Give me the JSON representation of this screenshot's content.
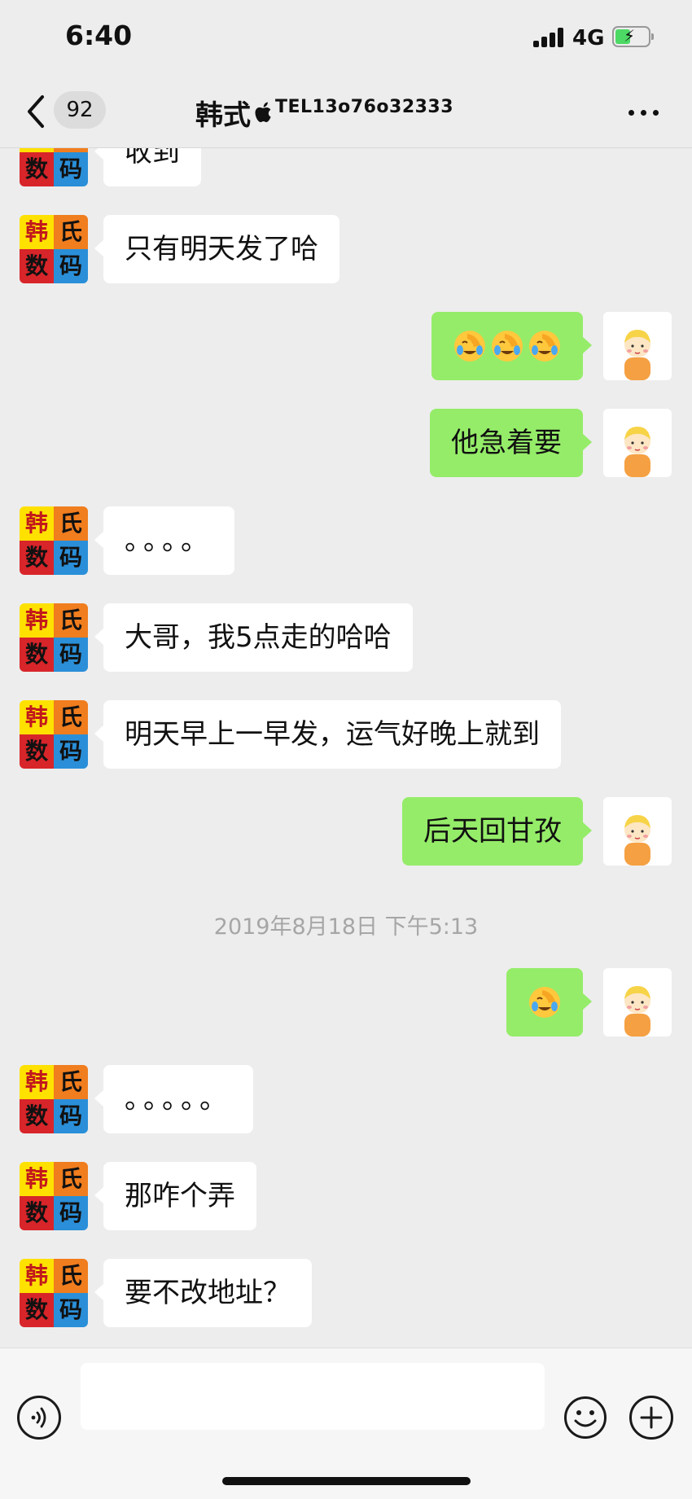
{
  "status_bar": {
    "time": "6:40",
    "network": "4G"
  },
  "header": {
    "back_icon": "chevron-left-icon",
    "unread_count": "92",
    "contact_name": "韩式",
    "contact_tel": "TEL13o76o32333",
    "more_icon": "more-dots-icon"
  },
  "avatars": {
    "shop": [
      "韩",
      "氏",
      "数",
      "码"
    ],
    "shop_colors": [
      "#ffe100",
      "#f07d1e",
      "#d7252a",
      "#2a8fd8"
    ]
  },
  "messages": [
    {
      "side": "in",
      "text": "收到"
    },
    {
      "side": "in",
      "text": "只有明天发了哈"
    },
    {
      "side": "out",
      "emoji": "facepalm-emoji",
      "emoji_count": 3
    },
    {
      "side": "out",
      "text": "他急着要"
    },
    {
      "side": "in",
      "text": "。。。。"
    },
    {
      "side": "in",
      "text": "大哥，我5点走的哈哈"
    },
    {
      "side": "in",
      "text": "明天早上一早发，运气好晚上就到"
    },
    {
      "side": "out",
      "text": "后天回甘孜"
    },
    {
      "timestamp": "2019年8月18日 下午5:13"
    },
    {
      "side": "out",
      "emoji": "facepalm-emoji",
      "emoji_count": 1
    },
    {
      "side": "in",
      "text": "。。。。。"
    },
    {
      "side": "in",
      "text": "那咋个弄"
    },
    {
      "side": "in",
      "text": "要不改地址？"
    }
  ],
  "input_bar": {
    "voice_icon": "voice-icon",
    "text_value": "",
    "emoji_icon": "emoji-icon",
    "plus_icon": "plus-icon"
  }
}
